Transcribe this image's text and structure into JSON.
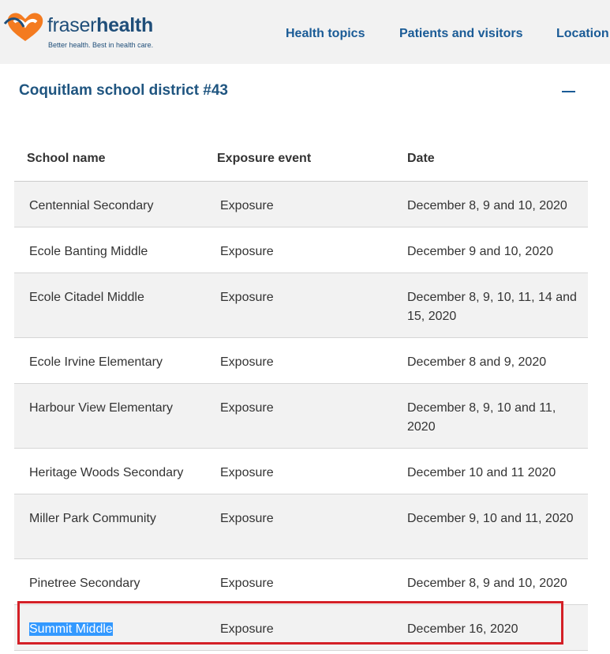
{
  "brand": {
    "name_part1": "fraser",
    "name_part2": "health",
    "tagline": "Better health. Best in health care."
  },
  "nav": {
    "items": [
      {
        "label": "Health topics"
      },
      {
        "label": "Patients and visitors"
      },
      {
        "label": "Location"
      }
    ]
  },
  "section": {
    "title": "Coquitlam school district #43",
    "toggle_icon": "minus-icon"
  },
  "table": {
    "headers": [
      "School name",
      "Exposure event",
      "Date"
    ],
    "rows": [
      {
        "school": "Centennial Secondary",
        "event": "Exposure",
        "date": "December 8, 9 and 10, 2020"
      },
      {
        "school": "Ecole Banting Middle",
        "event": "Exposure",
        "date": "December 9 and 10, 2020"
      },
      {
        "school": "Ecole Citadel Middle",
        "event": "Exposure",
        "date": "December 8, 9, 10, 11, 14 and 15, 2020"
      },
      {
        "school": "Ecole Irvine Elementary",
        "event": "Exposure",
        "date": "December 8 and 9, 2020"
      },
      {
        "school": "Harbour View Elementary",
        "event": "Exposure",
        "date": "December 8, 9, 10 and 11, 2020"
      },
      {
        "school": "Heritage Woods Secondary",
        "event": "Exposure",
        "date": "December 10 and 11 2020"
      },
      {
        "school": "Miller Park Community",
        "event": "Exposure",
        "date": "December 9, 10 and 11, 2020"
      },
      {
        "school": "Pinetree Secondary",
        "event": "Exposure",
        "date": "December 8, 9 and 10, 2020"
      },
      {
        "school": "Summit Middle",
        "event": "Exposure",
        "date": "December 16, 2020"
      }
    ]
  },
  "colors": {
    "brand_blue": "#1f4e79",
    "brand_orange": "#f47b20",
    "link_blue": "#1a5b96",
    "selection": "#3399ff",
    "highlight_border": "#d42027"
  }
}
